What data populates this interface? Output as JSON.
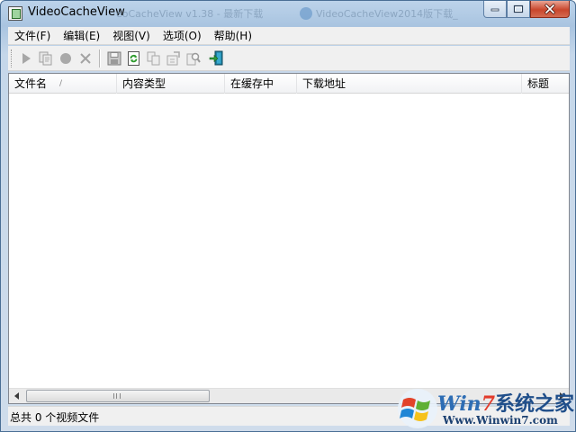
{
  "window": {
    "title": "VideoCacheView",
    "background_tabs": [
      "eoCacheView v1.38 - 最新下载",
      "VideoCacheView2014版下载_"
    ]
  },
  "menubar": {
    "items": [
      "文件(F)",
      "编辑(E)",
      "视图(V)",
      "选项(O)",
      "帮助(H)"
    ]
  },
  "toolbar": {
    "buttons": [
      {
        "icon": "play-icon",
        "enabled": false
      },
      {
        "icon": "copy-files-icon",
        "enabled": false
      },
      {
        "icon": "stop-icon",
        "enabled": false
      },
      {
        "icon": "delete-icon",
        "enabled": false
      },
      {
        "icon": "save-icon",
        "enabled": true
      },
      {
        "icon": "refresh-icon",
        "enabled": true
      },
      {
        "icon": "copy-icon",
        "enabled": false
      },
      {
        "icon": "properties-icon",
        "enabled": false
      },
      {
        "icon": "find-icon",
        "enabled": false
      },
      {
        "icon": "exit-icon",
        "enabled": true
      }
    ]
  },
  "listview": {
    "columns": [
      "文件名",
      "内容类型",
      "在缓存中",
      "下载地址",
      "标题"
    ],
    "sort_indicator": "/",
    "rows": []
  },
  "statusbar": {
    "text": "总共 0 个视频文件"
  },
  "watermark": {
    "brand_win": "Win",
    "brand_7": "7",
    "brand_cn": "系统之家",
    "url": "Www.Winwin7.com"
  },
  "colors": {
    "accent": "#2e6db4",
    "close_button": "#c9462c",
    "frame": "#a9c4e0"
  }
}
